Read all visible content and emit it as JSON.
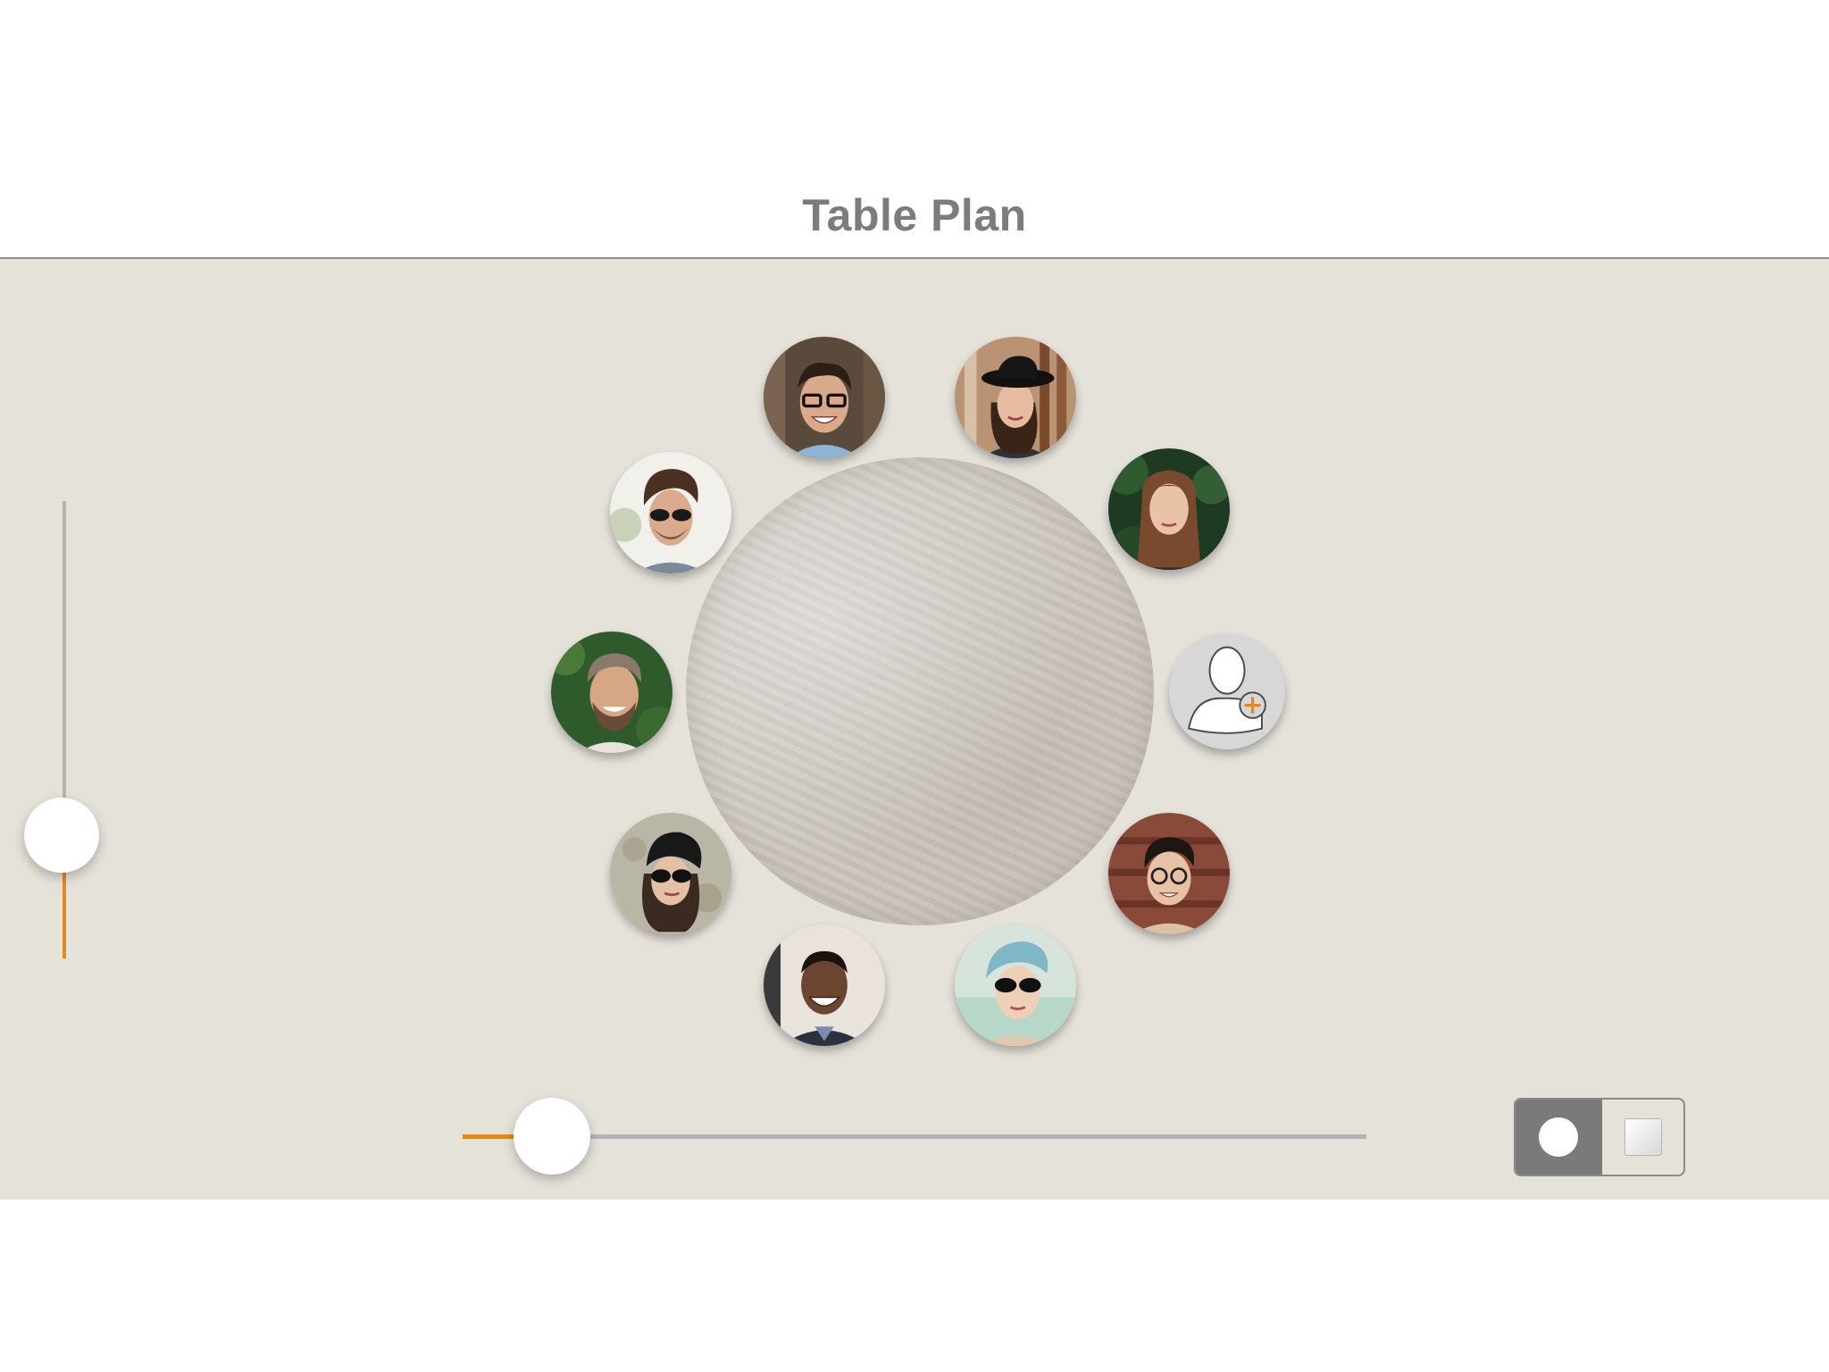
{
  "header": {
    "title": "Table Plan"
  },
  "table": {
    "shape": "round",
    "surface": "marble-texture"
  },
  "seats": [
    {
      "id": "seat-1",
      "icon": "avatar-man-glasses"
    },
    {
      "id": "seat-2",
      "icon": "avatar-woman-hat"
    },
    {
      "id": "seat-3",
      "icon": "avatar-woman-long-hair"
    },
    {
      "id": "seat-4",
      "icon": "add-guest-icon"
    },
    {
      "id": "seat-5",
      "icon": "avatar-woman-glasses-short-hair"
    },
    {
      "id": "seat-6",
      "icon": "avatar-woman-blue-hair-sunglasses"
    },
    {
      "id": "seat-7",
      "icon": "avatar-man-smiling"
    },
    {
      "id": "seat-8",
      "icon": "avatar-woman-beanie-sunglasses"
    },
    {
      "id": "seat-9",
      "icon": "avatar-man-beard"
    },
    {
      "id": "seat-10",
      "icon": "avatar-man-sunglasses"
    }
  ],
  "controls": {
    "vertical_slider": {
      "value": 0.27
    },
    "horizontal_slider": {
      "value": 0.07
    },
    "shape_toggle": {
      "options": [
        "round",
        "square"
      ],
      "selected": "round"
    }
  },
  "colors": {
    "accent": "#e08a1e",
    "canvas": "#e5e2da",
    "toggle_active": "#7a7a7a"
  }
}
